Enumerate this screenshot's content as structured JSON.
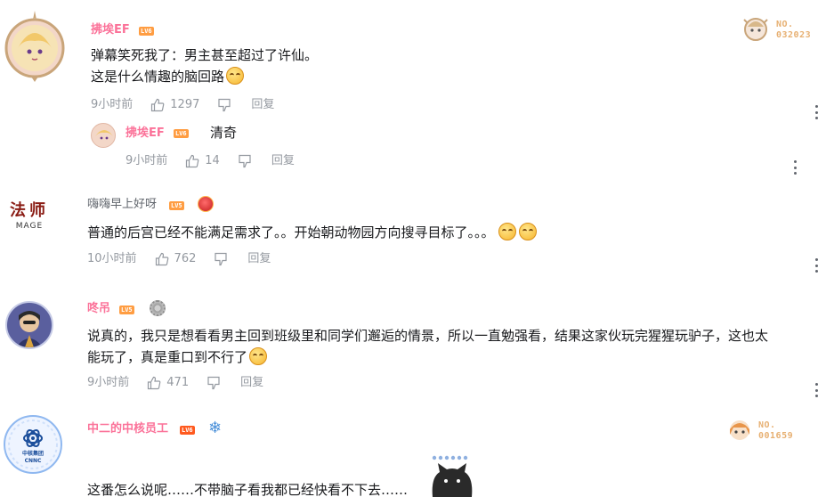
{
  "comments": [
    {
      "username": "拂埃EF",
      "level": "LV6",
      "text_line1": "弹幕笑死我了：男主甚至超过了许仙。",
      "text_line2": "这是什么情趣的脑回路",
      "time": "9小时前",
      "likes": "1297",
      "reply_label": "回复",
      "fan_badge_no": "NO.",
      "fan_badge_num": "032023",
      "sub_reply": {
        "username": "拂埃EF",
        "level": "LV6",
        "text": "清奇",
        "time": "9小时前",
        "likes": "14",
        "reply_label": "回复"
      }
    },
    {
      "username": "嗨嗨早上好呀",
      "level": "LV5",
      "avatar_text_top": "法师",
      "avatar_text_bottom": "MAGE",
      "text": "普通的后宫已经不能满足需求了。。开始朝动物园方向搜寻目标了。。。",
      "time": "10小时前",
      "likes": "762",
      "reply_label": "回复"
    },
    {
      "username": "咚吊",
      "level": "LV5",
      "text_line1": "说真的，我只是想看看男主回到班级里和同学们邂逅的情景，所以一直勉强看，结果这家伙玩完猩猩玩驴子，这也太",
      "text_line2": "能玩了，真是重口到不行了",
      "time": "9小时前",
      "likes": "471",
      "reply_label": "回复"
    },
    {
      "username": "中二的中核员工",
      "level": "LV6",
      "avatar_text": "中核集团 CNNC",
      "text": "这番怎么说呢……不带脑子看我都已经快看不下去……",
      "fan_badge_no": "NO.",
      "fan_badge_num": "001659"
    }
  ],
  "colors": {
    "username_vip": "#fb7299",
    "meta": "#9499a0",
    "text": "#18191c",
    "lv6": "#ff6c00",
    "lv5": "#ff9d42"
  }
}
